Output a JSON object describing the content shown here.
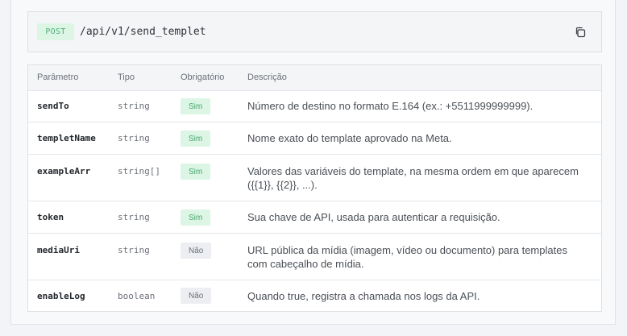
{
  "endpoint": {
    "method": "POST",
    "path": "/api/v1/send_templet",
    "copy_icon": "copy-icon"
  },
  "table": {
    "headers": [
      "Parâmetro",
      "Tipo",
      "Obrigatório",
      "Descrição"
    ],
    "rows": [
      {
        "name": "sendTo",
        "type": "string",
        "required": "Sim",
        "description": "Número de destino no formato E.164 (ex.: +5511999999999)."
      },
      {
        "name": "templetName",
        "type": "string",
        "required": "Sim",
        "description": "Nome exato do template aprovado na Meta."
      },
      {
        "name": "exampleArr",
        "type": "string[]",
        "required": "Sim",
        "description": "Valores das variáveis do template, na mesma ordem em que aparecem ({{1}}, {{2}}, ...)."
      },
      {
        "name": "token",
        "type": "string",
        "required": "Sim",
        "description": "Sua chave de API, usada para autenticar a requisição."
      },
      {
        "name": "mediaUri",
        "type": "string",
        "required": "Não",
        "description": "URL pública da mídia (imagem, vídeo ou documento) para templates com cabeçalho de mídia."
      },
      {
        "name": "enableLog",
        "type": "boolean",
        "required": "Não",
        "description": "Quando true, registra a chamada nos logs da API."
      }
    ]
  },
  "colors": {
    "required_yes_bg": "#dcf5e5",
    "required_yes_text": "#45a56f",
    "required_no_bg": "#eceef1"
  }
}
